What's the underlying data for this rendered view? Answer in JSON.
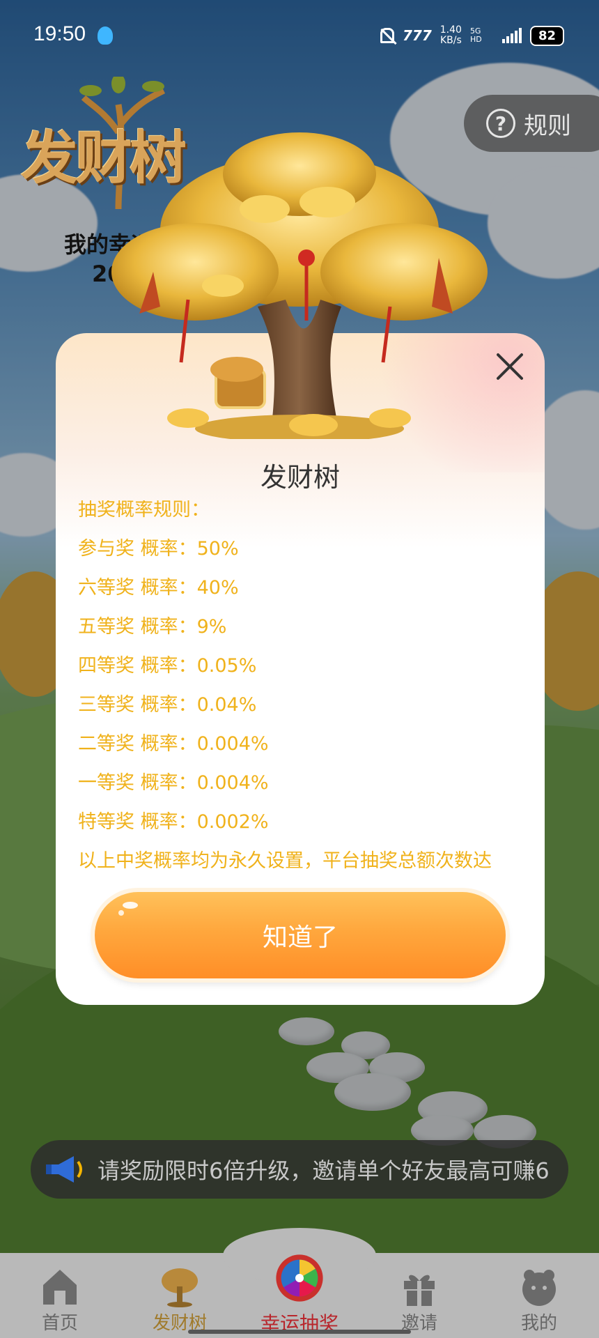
{
  "status_bar": {
    "time": "19:50",
    "net_speed_value": "1.40",
    "net_speed_unit": "KB/s",
    "network_label": "5G HD",
    "battery": "82"
  },
  "header": {
    "logo_text": "发财树",
    "luck_label": "我的幸运",
    "luck_value": "20",
    "rules_button": "规则"
  },
  "modal": {
    "title": "发财树",
    "rules": [
      "抽奖概率规则：",
      "参与奖  概率：50%",
      "六等奖  概率：40%",
      "五等奖  概率：9%",
      "四等奖  概率：0.05%",
      "三等奖  概率：0.04%",
      "二等奖  概率：0.004%",
      "一等奖  概率：0.004%",
      "特等奖  概率：0.002%",
      "以上中奖概率均为永久设置，平台抽奖总额次数达"
    ],
    "confirm_button": "知道了"
  },
  "announcement": {
    "text": "请奖励限时6倍升级，邀请单个好友最高可赚6"
  },
  "bottom_nav": {
    "items": [
      {
        "label": "首页",
        "icon": "home-icon"
      },
      {
        "label": "发财树",
        "icon": "money-tree-icon"
      },
      {
        "label": "幸运抽奖",
        "icon": "lucky-wheel-icon"
      },
      {
        "label": "邀请",
        "icon": "gift-icon"
      },
      {
        "label": "我的",
        "icon": "profile-icon"
      }
    ]
  },
  "colors": {
    "rule_text": "#f0b21b",
    "button_orange": "#ff9a30",
    "active_center": "#b8262c"
  }
}
